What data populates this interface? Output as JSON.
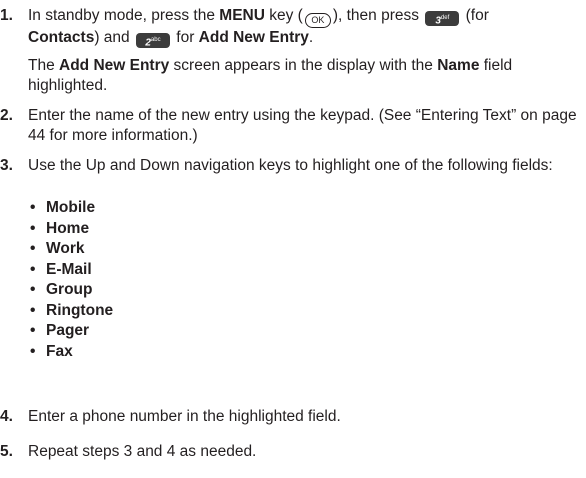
{
  "steps": [
    {
      "number": "1.",
      "line1": {
        "t1": "In standby mode, press the ",
        "b1": "MENU",
        "t2": " key (",
        "key_ok": "OK",
        "t3": "), then press ",
        "key3_main": "3",
        "key3_sub": "def",
        "t4": " (for"
      },
      "line2": {
        "b1": "Contacts",
        "t1": ") and ",
        "key2_main": "2",
        "key2_sub": "abc",
        "t2": " for ",
        "b2": "Add New Entry",
        "t3": "."
      },
      "note": {
        "t1": "The ",
        "b1": "Add New Entry",
        "t2": " screen appears in the display with the ",
        "b2": "Name",
        "t3": " field highlighted."
      }
    },
    {
      "number": "2.",
      "text": "Enter the name of the new entry using the keypad. (See “Entering Text” on page 44 for more information.)"
    },
    {
      "number": "3.",
      "text": "Use the Up and Down navigation keys to highlight one of the following fields:",
      "fields": [
        "Mobile",
        "Home",
        "Work",
        "E-Mail",
        "Group",
        "Ringtone",
        "Pager",
        "Fax"
      ]
    },
    {
      "number": "4.",
      "text": "Enter a phone number in the highlighted field."
    },
    {
      "number": "5.",
      "text": "Repeat steps 3 and 4 as needed."
    }
  ]
}
